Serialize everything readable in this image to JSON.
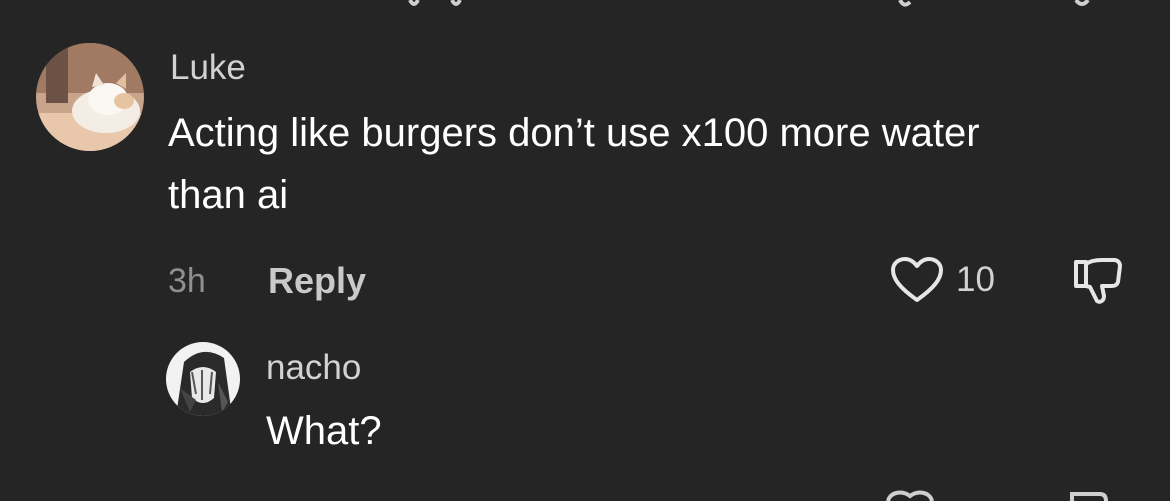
{
  "colors": {
    "background": "#252525",
    "text_primary": "#ffffff",
    "text_secondary": "#d2d2d2",
    "text_muted": "#8f8f8f"
  },
  "comment": {
    "username": "Luke",
    "text": "Acting like burgers don’t use x100 more water than ai",
    "time": "3h",
    "reply_label": "Reply",
    "like_count": "10",
    "like_icon": "heart-outline-icon",
    "dislike_icon": "thumbs-down-icon",
    "avatar": "cat-avatar"
  },
  "reply": {
    "username": "nacho",
    "text": "What?",
    "avatar": "anime-character-avatar"
  }
}
